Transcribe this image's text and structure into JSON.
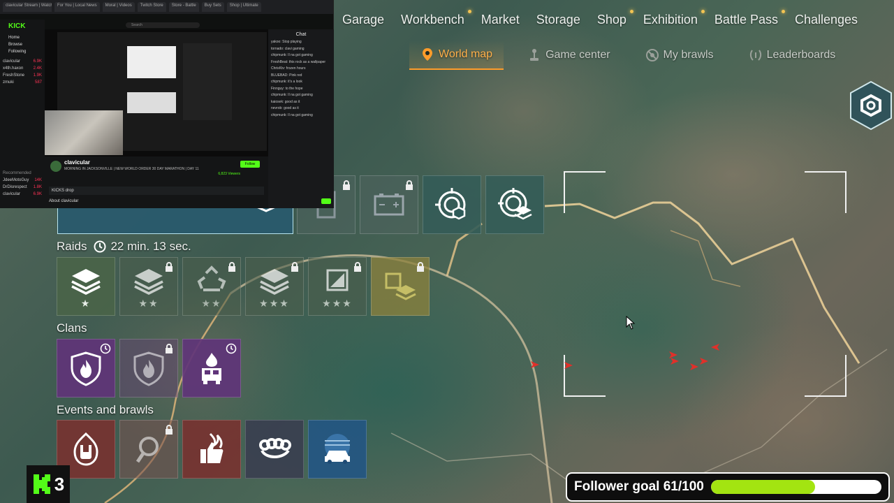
{
  "top_nav": {
    "tabs": [
      {
        "label": "Garage",
        "dot": false
      },
      {
        "label": "Workbench",
        "dot": true
      },
      {
        "label": "Market",
        "dot": false
      },
      {
        "label": "Storage",
        "dot": false
      },
      {
        "label": "Shop",
        "dot": true
      },
      {
        "label": "Exhibition",
        "dot": true
      },
      {
        "label": "Battle Pass",
        "dot": true
      },
      {
        "label": "Challenges",
        "dot": false
      }
    ]
  },
  "sub_nav": {
    "tabs": [
      {
        "label": "World map",
        "icon": "map-pin-icon",
        "active": true
      },
      {
        "label": "Game center",
        "icon": "joystick-icon",
        "active": false
      },
      {
        "label": "My brawls",
        "icon": "no-brawl-icon",
        "active": false
      },
      {
        "label": "Leaderboards",
        "icon": "laurel-icon",
        "active": false
      }
    ]
  },
  "raids": {
    "label": "Raids",
    "timer": "22 min. 13 sec."
  },
  "clans": {
    "label": "Clans"
  },
  "events": {
    "label": "Events and brawls"
  },
  "follower_goal": {
    "label": "Follower goal 61/100",
    "current": 61,
    "target": 100,
    "fill_color": "#a3e411"
  },
  "kick_badge": {
    "number": "3"
  },
  "stream": {
    "browser_tabs": [
      "clavicular Stream | Watch Live",
      "For You | Local News",
      "Moral | Videos",
      "Twitch Store",
      "Store - Battle",
      "Buy Sets",
      "Shop | Ultimate"
    ],
    "search_placeholder": "Search",
    "sidebar": {
      "logo": "KICK",
      "nav": [
        "Home",
        "Browse",
        "Following"
      ],
      "section": "Following",
      "following": [
        {
          "name": "clavicular",
          "viewers": "6.9K"
        },
        {
          "name": "x4th.haxon",
          "viewers": "2.4K"
        },
        {
          "name": "FreshStone",
          "viewers": "1.9K"
        },
        {
          "name": "zmuki",
          "viewers": "587"
        }
      ],
      "recommended_title": "Recommended",
      "recommended": [
        {
          "name": "JdeeMotoGuy",
          "viewers": "14K"
        },
        {
          "name": "DrDisrespect",
          "viewers": "1.8K"
        },
        {
          "name": "clavicular",
          "viewers": "6.9K"
        }
      ]
    },
    "channel": {
      "name": "clavicular",
      "title": "MORNING IN JACKSONVILLE | NEW WORLD ORDER 30 DAY MARATHON | DAY 11",
      "follow_label": "Follow",
      "viewers": "6,823 Viewers",
      "drops": "KICKS drop",
      "about": "About clavicular"
    },
    "chat": {
      "title": "Chat",
      "messages": [
        "yakoo: Stop playing",
        "tornado: clavi gaming",
        "chipmunk: Il na got gaming",
        "FreshBeat: this rock as a wallpaper",
        "ChrisKtv: frozen hours",
        "BLUEBAD: Pink red",
        "chipmunk: it's a look",
        "Finnguy: to the hope",
        "chipmunk: Il na got gaming",
        "kaiosek: good as it",
        "nevrob: good as it",
        "chipmunk: Il na got gaming"
      ]
    }
  }
}
